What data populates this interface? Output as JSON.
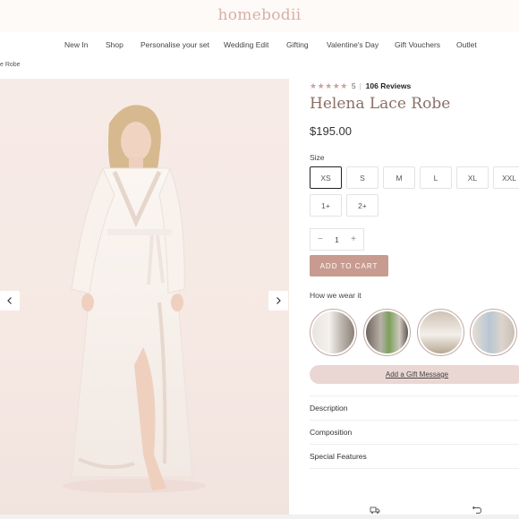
{
  "brand": {
    "logo": "homebodii"
  },
  "nav": {
    "items": [
      {
        "label": "New In"
      },
      {
        "label": "Shop"
      },
      {
        "label": "Personalise your set"
      },
      {
        "label": "Wedding Edit"
      },
      {
        "label": "Gifting"
      },
      {
        "label": "Valentine's Day"
      },
      {
        "label": "Gift Vouchers"
      },
      {
        "label": "Outlet"
      }
    ]
  },
  "breadcrumb": "e Robe",
  "gallery": {
    "prev_icon": "chevron-left-icon",
    "next_icon": "chevron-right-icon"
  },
  "product": {
    "rating": {
      "stars": "★★★★★",
      "value": "5",
      "separator": "|",
      "reviews": "106 Reviews"
    },
    "title": "Helena Lace Robe",
    "price": "$195.00",
    "size_label": "Size",
    "sizes": [
      {
        "label": "XS",
        "selected": true
      },
      {
        "label": "S"
      },
      {
        "label": "M"
      },
      {
        "label": "L"
      },
      {
        "label": "XL"
      },
      {
        "label": "XXL"
      },
      {
        "label": "1+"
      },
      {
        "label": "2+"
      }
    ],
    "quantity": {
      "minus": "−",
      "value": "1",
      "plus": "+"
    },
    "add_to_cart": "ADD TO CART",
    "wear_label": "How we wear it",
    "gift_message": "Add a Gift Message",
    "accordion": [
      {
        "label": "Description"
      },
      {
        "label": "Composition"
      },
      {
        "label": "Special Features"
      }
    ]
  },
  "colors": {
    "accent": "#c89b90",
    "title": "#8a6f66",
    "logo": "#d8b0a4",
    "gift_bg": "#ead7d3"
  },
  "bottom_icons": [
    "delivery-truck-icon",
    "return-arrow-icon"
  ]
}
